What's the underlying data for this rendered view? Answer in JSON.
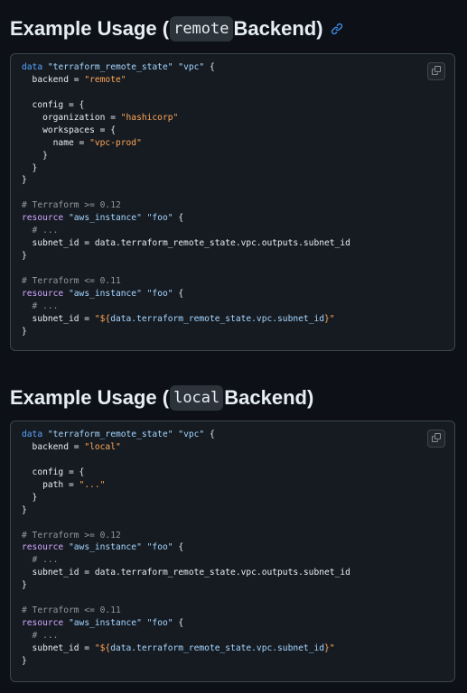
{
  "sections": [
    {
      "heading_prefix": "Example Usage (",
      "heading_code": "remote",
      "heading_suffix": " Backend)",
      "lines": [
        [
          [
            "kw",
            "data"
          ],
          [
            "txt",
            " "
          ],
          [
            "str",
            "\"terraform_remote_state\""
          ],
          [
            "txt",
            " "
          ],
          [
            "str",
            "\"vpc\""
          ],
          [
            "txt",
            " {"
          ]
        ],
        [
          [
            "txt",
            "  backend = "
          ],
          [
            "ostr",
            "\"remote\""
          ]
        ],
        [],
        [
          [
            "txt",
            "  config = {"
          ]
        ],
        [
          [
            "txt",
            "    organization = "
          ],
          [
            "ostr",
            "\"hashicorp\""
          ]
        ],
        [
          [
            "txt",
            "    workspaces = {"
          ]
        ],
        [
          [
            "txt",
            "      name = "
          ],
          [
            "ostr",
            "\"vpc-prod\""
          ]
        ],
        [
          [
            "txt",
            "    }"
          ]
        ],
        [
          [
            "txt",
            "  }"
          ]
        ],
        [
          [
            "txt",
            "}"
          ]
        ],
        [],
        [
          [
            "com",
            "# Terraform >= 0.12"
          ]
        ],
        [
          [
            "rk",
            "resource"
          ],
          [
            "txt",
            " "
          ],
          [
            "str",
            "\"aws_instance\""
          ],
          [
            "txt",
            " "
          ],
          [
            "str",
            "\"foo\""
          ],
          [
            "txt",
            " {"
          ]
        ],
        [
          [
            "com",
            "  # ..."
          ]
        ],
        [
          [
            "txt",
            "  subnet_id = data.terraform_remote_state.vpc.outputs.subnet_id"
          ]
        ],
        [
          [
            "txt",
            "}"
          ]
        ],
        [],
        [
          [
            "com",
            "# Terraform <= 0.11"
          ]
        ],
        [
          [
            "rk",
            "resource"
          ],
          [
            "txt",
            " "
          ],
          [
            "str",
            "\"aws_instance\""
          ],
          [
            "txt",
            " "
          ],
          [
            "str",
            "\"foo\""
          ],
          [
            "txt",
            " {"
          ]
        ],
        [
          [
            "com",
            "  # ..."
          ]
        ],
        [
          [
            "txt",
            "  subnet_id = "
          ],
          [
            "ostr",
            "\"${"
          ],
          [
            "str",
            "data.terraform_remote_state.vpc.subnet_id"
          ],
          [
            "ostr",
            "}\""
          ]
        ],
        [
          [
            "txt",
            "}"
          ]
        ]
      ]
    },
    {
      "heading_prefix": "Example Usage (",
      "heading_code": "local",
      "heading_suffix": " Backend)",
      "lines": [
        [
          [
            "kw",
            "data"
          ],
          [
            "txt",
            " "
          ],
          [
            "str",
            "\"terraform_remote_state\""
          ],
          [
            "txt",
            " "
          ],
          [
            "str",
            "\"vpc\""
          ],
          [
            "txt",
            " {"
          ]
        ],
        [
          [
            "txt",
            "  backend = "
          ],
          [
            "ostr",
            "\"local\""
          ]
        ],
        [],
        [
          [
            "txt",
            "  config = {"
          ]
        ],
        [
          [
            "txt",
            "    path = "
          ],
          [
            "ostr",
            "\"...\""
          ]
        ],
        [
          [
            "txt",
            "  }"
          ]
        ],
        [
          [
            "txt",
            "}"
          ]
        ],
        [],
        [
          [
            "com",
            "# Terraform >= 0.12"
          ]
        ],
        [
          [
            "rk",
            "resource"
          ],
          [
            "txt",
            " "
          ],
          [
            "str",
            "\"aws_instance\""
          ],
          [
            "txt",
            " "
          ],
          [
            "str",
            "\"foo\""
          ],
          [
            "txt",
            " {"
          ]
        ],
        [
          [
            "com",
            "  # ..."
          ]
        ],
        [
          [
            "txt",
            "  subnet_id = data.terraform_remote_state.vpc.outputs.subnet_id"
          ]
        ],
        [
          [
            "txt",
            "}"
          ]
        ],
        [],
        [
          [
            "com",
            "# Terraform <= 0.11"
          ]
        ],
        [
          [
            "rk",
            "resource"
          ],
          [
            "txt",
            " "
          ],
          [
            "str",
            "\"aws_instance\""
          ],
          [
            "txt",
            " "
          ],
          [
            "str",
            "\"foo\""
          ],
          [
            "txt",
            " {"
          ]
        ],
        [
          [
            "com",
            "  # ..."
          ]
        ],
        [
          [
            "txt",
            "  subnet_id = "
          ],
          [
            "ostr",
            "\"${"
          ],
          [
            "str",
            "data.terraform_remote_state.vpc.subnet_id"
          ],
          [
            "ostr",
            "}\""
          ]
        ],
        [
          [
            "txt",
            "}"
          ]
        ]
      ]
    }
  ],
  "icons": {
    "anchor": "link-icon",
    "copy": "copy-icon"
  },
  "colors": {
    "background": "#0d1117",
    "code_background": "#161b22",
    "keyword": "#58a6ff",
    "string": "#a5d6ff",
    "comment": "#9198a1",
    "resource_keyword": "#d2a8ff",
    "value_string": "#ffa657",
    "link": "#4493f8"
  }
}
